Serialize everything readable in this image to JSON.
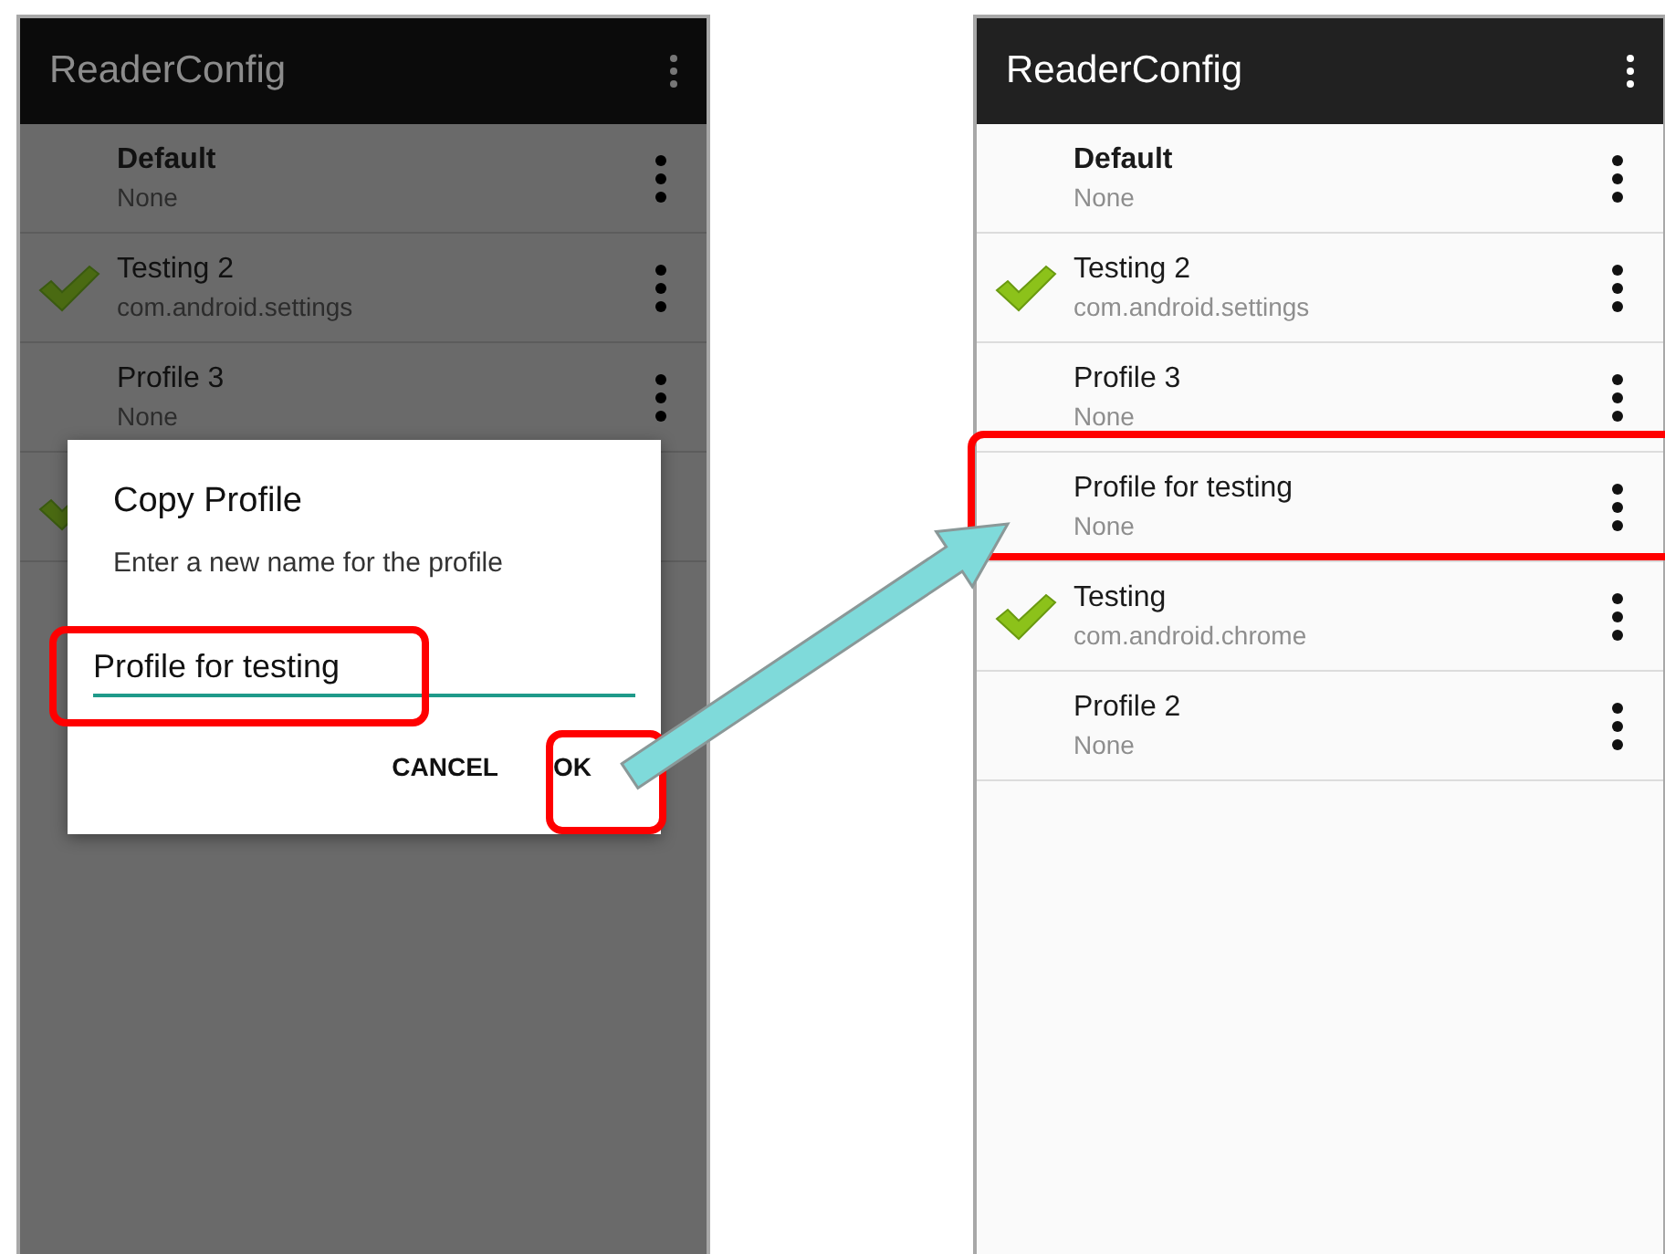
{
  "screens": [
    {
      "app_title": "ReaderConfig",
      "dimmed": true,
      "profiles": [
        {
          "title": "Default",
          "subtitle": "None",
          "bold": true,
          "active": false
        },
        {
          "title": "Testing 2",
          "subtitle": "com.android.settings",
          "bold": false,
          "active": true
        },
        {
          "title": "Profile 3",
          "subtitle": "None",
          "bold": false,
          "active": false
        },
        {
          "active": true
        }
      ],
      "dialog": {
        "title": "Copy Profile",
        "message": "Enter a new name for the profile",
        "value": "Profile for testing",
        "buttons": [
          "CANCEL",
          "OK"
        ]
      }
    },
    {
      "app_title": "ReaderConfig",
      "dimmed": false,
      "profiles": [
        {
          "title": "Default",
          "subtitle": "None",
          "bold": true,
          "active": false
        },
        {
          "title": "Testing 2",
          "subtitle": "com.android.settings",
          "bold": false,
          "active": true
        },
        {
          "title": "Profile 3",
          "subtitle": "None",
          "bold": false,
          "active": false
        },
        {
          "title": "Profile for testing",
          "subtitle": "None",
          "bold": false,
          "active": false
        },
        {
          "title": "Testing",
          "subtitle": "com.android.chrome",
          "bold": false,
          "active": true
        },
        {
          "title": "Profile 2",
          "subtitle": "None",
          "bold": false,
          "active": false
        }
      ]
    }
  ]
}
